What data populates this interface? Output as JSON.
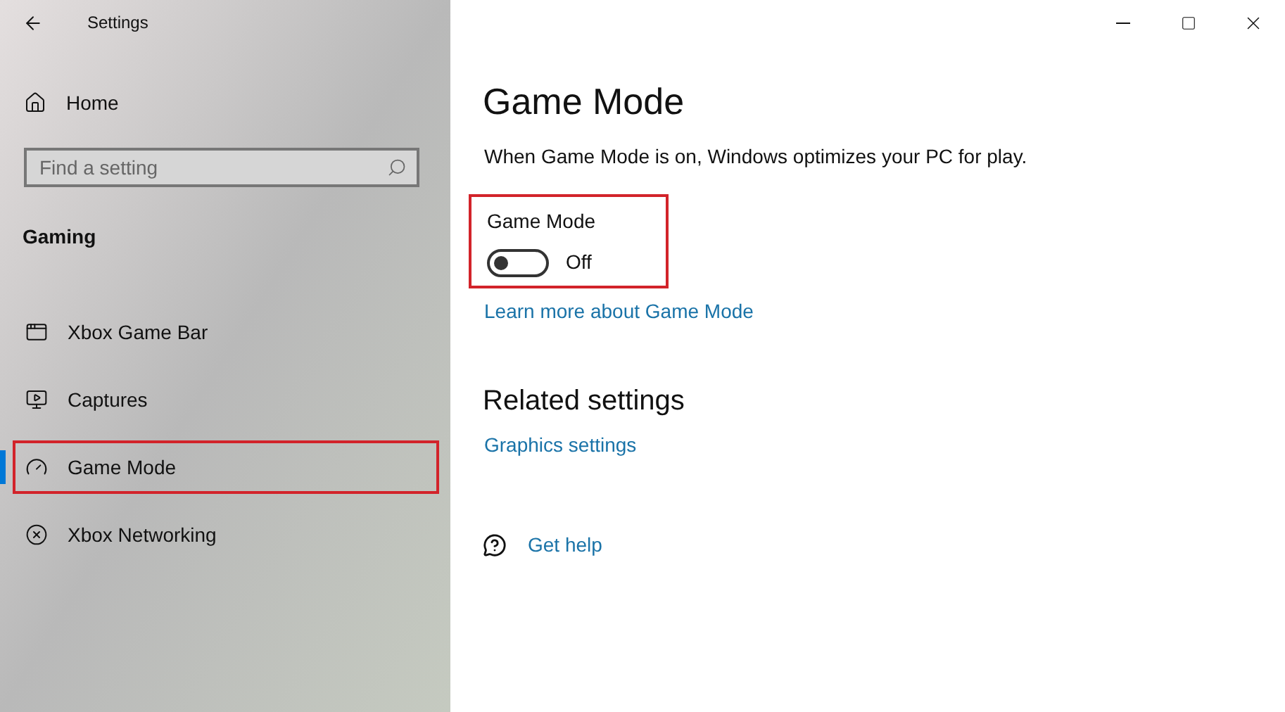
{
  "window": {
    "title": "Settings"
  },
  "sidebar": {
    "home": "Home",
    "search": {
      "placeholder": "Find a setting"
    },
    "section": "Gaming",
    "items": [
      {
        "label": "Xbox Game Bar",
        "selected": false,
        "highlighted": false
      },
      {
        "label": "Captures",
        "selected": false,
        "highlighted": false
      },
      {
        "label": "Game Mode",
        "selected": true,
        "highlighted": true
      },
      {
        "label": "Xbox Networking",
        "selected": false,
        "highlighted": false
      }
    ]
  },
  "main": {
    "title": "Game Mode",
    "description": "When Game Mode is on, Windows optimizes your PC for play.",
    "toggle": {
      "label": "Game Mode",
      "on": false,
      "state_text": "Off",
      "highlighted": true
    },
    "link": "Learn more about Game Mode",
    "related_title": "Related settings",
    "related_links": [
      "Graphics settings"
    ],
    "help": "Get help"
  }
}
